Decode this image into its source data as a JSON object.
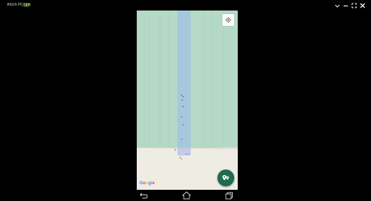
{
  "window": {
    "title": "ASUS PC Link",
    "controls": [
      "collapse-icon",
      "minimize-icon",
      "fullscreen-icon",
      "close-icon"
    ]
  },
  "map": {
    "attribution": "Google",
    "attribution_letters": [
      "G",
      "o",
      "o",
      "g",
      "l",
      "e"
    ],
    "colors": {
      "park": "#b5d9c7",
      "water": "#a6c8dc",
      "land": "#efece3"
    }
  },
  "controls": {
    "locate": "my-location-icon",
    "fab": "place-icon"
  },
  "nav": [
    "back-icon",
    "home-icon",
    "recents-icon"
  ]
}
